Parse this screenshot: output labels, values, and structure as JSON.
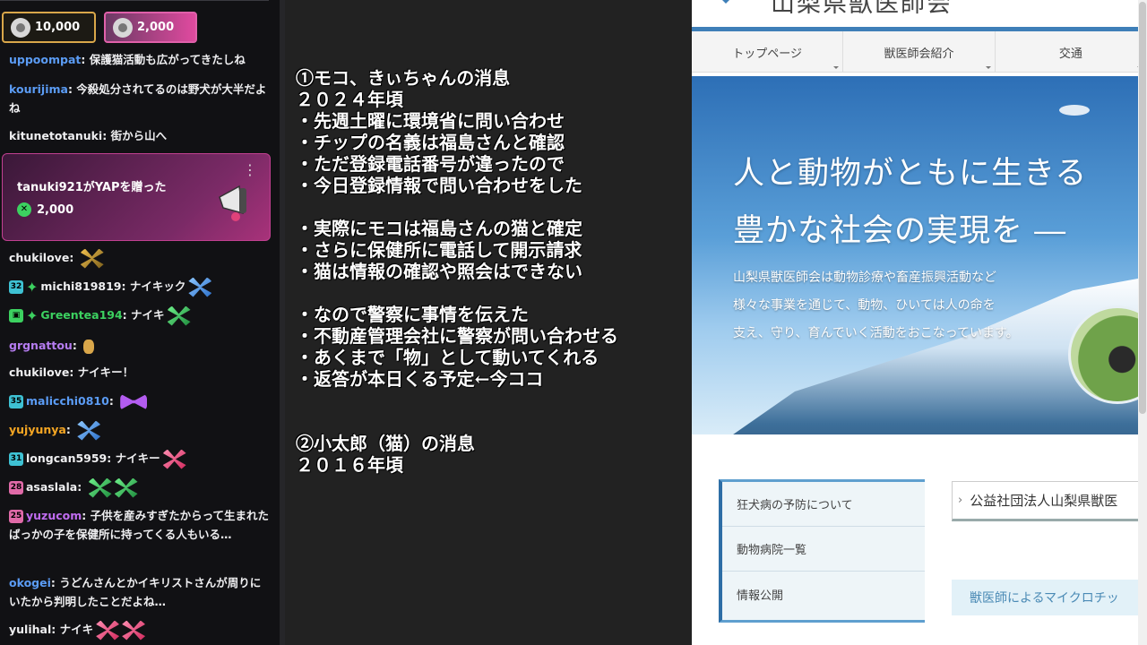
{
  "chat": {
    "cheers": [
      {
        "amount": "10,000",
        "color": "#d9a74a"
      },
      {
        "amount": "2,000",
        "color": "#e04a9f"
      }
    ],
    "messages": [
      {
        "user": "uppoompat",
        "color": "#5b9cf5",
        "text": ": 保護猫活動も広がってきたしね"
      },
      {
        "user": "kourijima",
        "color": "#5b9cf5",
        "text": ": 今殺処分されてるのは野犬が大半だよね"
      },
      {
        "user": "kitunetotanuki",
        "color": "#efeff1",
        "text": ": 街から山へ"
      },
      {
        "user": "chukilove",
        "color": "#efeff1",
        "text": ": "
      },
      {
        "user": "michi819819",
        "color": "#efeff1",
        "badge": "32",
        "text": ": ナイキック"
      },
      {
        "user": "Greentea194",
        "color": "#3cd160",
        "text": ": ナイキ"
      },
      {
        "user": "grgnattou",
        "color": "#b57cf0",
        "text": ": "
      },
      {
        "user": "chukilove",
        "color": "#efeff1",
        "text": ": ナイキー！"
      },
      {
        "user": "malicchi0810",
        "color": "#5b9cf5",
        "badge": "35",
        "text": ": "
      },
      {
        "user": "yujyunya",
        "color": "#f5a623",
        "text": ": "
      },
      {
        "user": "longcan5959",
        "color": "#efeff1",
        "badge": "31",
        "text": ": ナイキー"
      },
      {
        "user": "asaslala",
        "color": "#efeff1",
        "badge": "28",
        "text": ": "
      },
      {
        "user": "yuzucom",
        "color": "#c06cf0",
        "badge": "25",
        "text": ": 子供を産みすぎたからって生まれたばっかの子を保健所に持ってくる人もいる…"
      },
      {
        "user": "okogei",
        "color": "#5b9cf5",
        "text": ": うどんさんとかイキリストさんが周りにいたから判明したことだよね…"
      },
      {
        "user": "yulihal",
        "color": "#efeff1",
        "text": ": ナイキ"
      }
    ],
    "gift": {
      "text": "tanuki921がYAPを贈った",
      "amount": "2,000"
    }
  },
  "memo": {
    "lines": [
      "①モコ、きぃちゃんの消息",
      "２０２４年頃",
      "・先週土曜に環境省に問い合わせ",
      "・チップの名義は福島さんと確認",
      "・ただ登録電話番号が違ったので",
      "・今日登録情報で問い合わせをした",
      "",
      "・実際にモコは福島さんの猫と確定",
      "・さらに保健所に電話して開示請求",
      "・猫は情報の確認や照会はできない",
      "",
      "・なので警察に事情を伝えた",
      "・不動産管理会社に警察が問い合わせる",
      "・あくまで「物」として動いてくれる",
      "・返答が本日くる予定←今ココ",
      "",
      "",
      "②小太郎（猫）の消息",
      "２０１６年頃"
    ]
  },
  "site": {
    "name": "山梨県獣医師会",
    "nav": [
      "トップページ",
      "獣医師会紹介",
      "交通"
    ],
    "hero_title_1": "人と動物がともに生きる",
    "hero_title_2": "豊かな社会の実現を ―",
    "hero_text": [
      "山梨県獣医師会は動物診療や畜産振興活動など",
      "様々な事業を通じて、動物、ひいては人の命を",
      "支え、守り、育んでいく活動をおこなっています。"
    ],
    "side_menu": [
      "狂犬病の予防について",
      "動物病院一覧",
      "情報公開"
    ],
    "breadcrumb": "公益社団法人山梨県獣医",
    "micro_banner": "獣医師によるマイクロチッ",
    "accent": "#3e7fb8"
  }
}
